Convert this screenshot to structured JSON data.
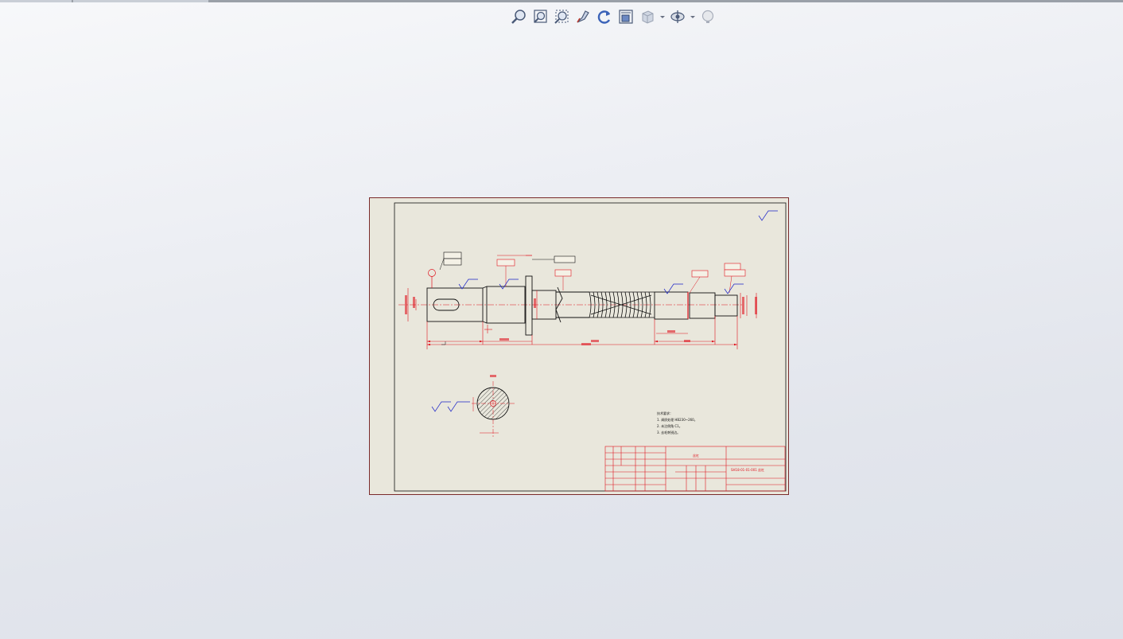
{
  "toolbar": {
    "items": [
      {
        "icon": "zoom-to-fit-icon"
      },
      {
        "icon": "zoom-to-area-icon"
      },
      {
        "icon": "zoom-in-out-icon"
      },
      {
        "icon": "pan-icon"
      },
      {
        "icon": "rotate-icon"
      },
      {
        "icon": "view-orientation-icon"
      },
      {
        "icon": "display-style-icon",
        "dropdown": true
      },
      {
        "icon": "hide-show-items-icon",
        "dropdown": true
      },
      {
        "icon": "appearance-icon"
      }
    ]
  },
  "drawing": {
    "notes_title": "技术要求：",
    "notes": [
      "1. 调质处理 HB230~260。",
      "2. 未注倒角 C1。",
      "3. 去毛刺锐边。"
    ],
    "title_block": {
      "part_name": "丝杠",
      "drawing_number": "SH18-01-01-001 丝杠"
    }
  },
  "colors": {
    "line": "#e0141e",
    "surface": "#1a23c8",
    "ink": "#111111",
    "paper": "#e9e7dc",
    "border": "#7a2a2a"
  }
}
